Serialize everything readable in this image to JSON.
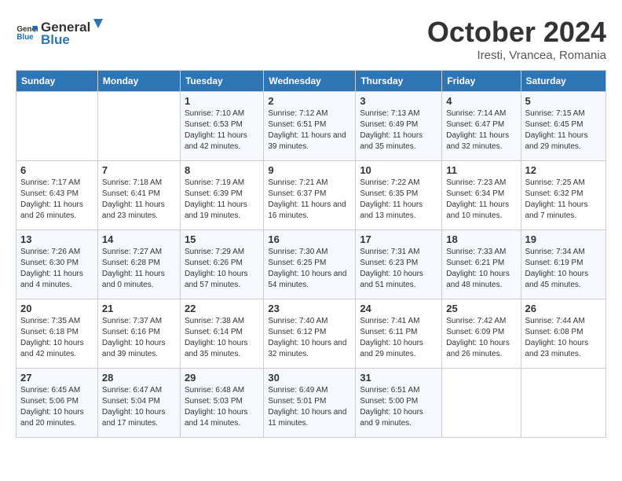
{
  "header": {
    "logo_general": "General",
    "logo_blue": "Blue",
    "month_title": "October 2024",
    "location": "Iresti, Vrancea, Romania"
  },
  "days_of_week": [
    "Sunday",
    "Monday",
    "Tuesday",
    "Wednesday",
    "Thursday",
    "Friday",
    "Saturday"
  ],
  "weeks": [
    [
      {
        "day": "",
        "info": ""
      },
      {
        "day": "",
        "info": ""
      },
      {
        "day": "1",
        "info": "Sunrise: 7:10 AM\nSunset: 6:53 PM\nDaylight: 11 hours and 42 minutes."
      },
      {
        "day": "2",
        "info": "Sunrise: 7:12 AM\nSunset: 6:51 PM\nDaylight: 11 hours and 39 minutes."
      },
      {
        "day": "3",
        "info": "Sunrise: 7:13 AM\nSunset: 6:49 PM\nDaylight: 11 hours and 35 minutes."
      },
      {
        "day": "4",
        "info": "Sunrise: 7:14 AM\nSunset: 6:47 PM\nDaylight: 11 hours and 32 minutes."
      },
      {
        "day": "5",
        "info": "Sunrise: 7:15 AM\nSunset: 6:45 PM\nDaylight: 11 hours and 29 minutes."
      }
    ],
    [
      {
        "day": "6",
        "info": "Sunrise: 7:17 AM\nSunset: 6:43 PM\nDaylight: 11 hours and 26 minutes."
      },
      {
        "day": "7",
        "info": "Sunrise: 7:18 AM\nSunset: 6:41 PM\nDaylight: 11 hours and 23 minutes."
      },
      {
        "day": "8",
        "info": "Sunrise: 7:19 AM\nSunset: 6:39 PM\nDaylight: 11 hours and 19 minutes."
      },
      {
        "day": "9",
        "info": "Sunrise: 7:21 AM\nSunset: 6:37 PM\nDaylight: 11 hours and 16 minutes."
      },
      {
        "day": "10",
        "info": "Sunrise: 7:22 AM\nSunset: 6:35 PM\nDaylight: 11 hours and 13 minutes."
      },
      {
        "day": "11",
        "info": "Sunrise: 7:23 AM\nSunset: 6:34 PM\nDaylight: 11 hours and 10 minutes."
      },
      {
        "day": "12",
        "info": "Sunrise: 7:25 AM\nSunset: 6:32 PM\nDaylight: 11 hours and 7 minutes."
      }
    ],
    [
      {
        "day": "13",
        "info": "Sunrise: 7:26 AM\nSunset: 6:30 PM\nDaylight: 11 hours and 4 minutes."
      },
      {
        "day": "14",
        "info": "Sunrise: 7:27 AM\nSunset: 6:28 PM\nDaylight: 11 hours and 0 minutes."
      },
      {
        "day": "15",
        "info": "Sunrise: 7:29 AM\nSunset: 6:26 PM\nDaylight: 10 hours and 57 minutes."
      },
      {
        "day": "16",
        "info": "Sunrise: 7:30 AM\nSunset: 6:25 PM\nDaylight: 10 hours and 54 minutes."
      },
      {
        "day": "17",
        "info": "Sunrise: 7:31 AM\nSunset: 6:23 PM\nDaylight: 10 hours and 51 minutes."
      },
      {
        "day": "18",
        "info": "Sunrise: 7:33 AM\nSunset: 6:21 PM\nDaylight: 10 hours and 48 minutes."
      },
      {
        "day": "19",
        "info": "Sunrise: 7:34 AM\nSunset: 6:19 PM\nDaylight: 10 hours and 45 minutes."
      }
    ],
    [
      {
        "day": "20",
        "info": "Sunrise: 7:35 AM\nSunset: 6:18 PM\nDaylight: 10 hours and 42 minutes."
      },
      {
        "day": "21",
        "info": "Sunrise: 7:37 AM\nSunset: 6:16 PM\nDaylight: 10 hours and 39 minutes."
      },
      {
        "day": "22",
        "info": "Sunrise: 7:38 AM\nSunset: 6:14 PM\nDaylight: 10 hours and 35 minutes."
      },
      {
        "day": "23",
        "info": "Sunrise: 7:40 AM\nSunset: 6:12 PM\nDaylight: 10 hours and 32 minutes."
      },
      {
        "day": "24",
        "info": "Sunrise: 7:41 AM\nSunset: 6:11 PM\nDaylight: 10 hours and 29 minutes."
      },
      {
        "day": "25",
        "info": "Sunrise: 7:42 AM\nSunset: 6:09 PM\nDaylight: 10 hours and 26 minutes."
      },
      {
        "day": "26",
        "info": "Sunrise: 7:44 AM\nSunset: 6:08 PM\nDaylight: 10 hours and 23 minutes."
      }
    ],
    [
      {
        "day": "27",
        "info": "Sunrise: 6:45 AM\nSunset: 5:06 PM\nDaylight: 10 hours and 20 minutes."
      },
      {
        "day": "28",
        "info": "Sunrise: 6:47 AM\nSunset: 5:04 PM\nDaylight: 10 hours and 17 minutes."
      },
      {
        "day": "29",
        "info": "Sunrise: 6:48 AM\nSunset: 5:03 PM\nDaylight: 10 hours and 14 minutes."
      },
      {
        "day": "30",
        "info": "Sunrise: 6:49 AM\nSunset: 5:01 PM\nDaylight: 10 hours and 11 minutes."
      },
      {
        "day": "31",
        "info": "Sunrise: 6:51 AM\nSunset: 5:00 PM\nDaylight: 10 hours and 9 minutes."
      },
      {
        "day": "",
        "info": ""
      },
      {
        "day": "",
        "info": ""
      }
    ]
  ]
}
